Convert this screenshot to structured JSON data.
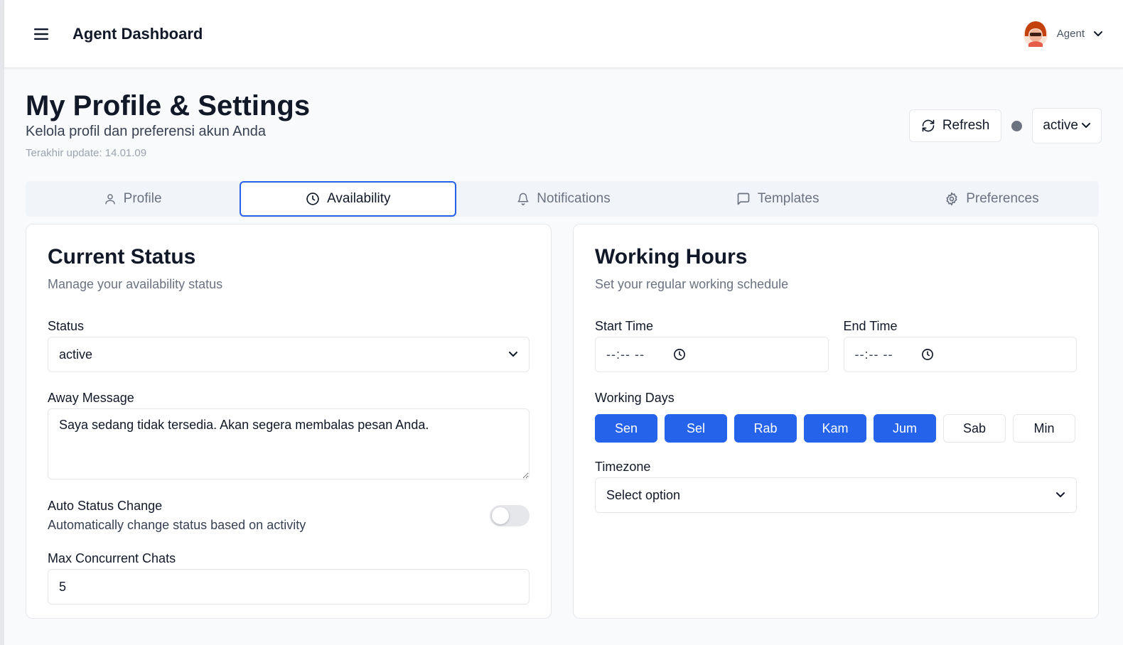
{
  "header": {
    "app_title": "Agent Dashboard",
    "user_name": "Agent"
  },
  "page": {
    "title": "My Profile & Settings",
    "subtitle": "Kelola profil dan preferensi akun Anda",
    "updated": "Terakhir update: 14.01.09",
    "refresh_label": "Refresh",
    "status_value": "active"
  },
  "tabs": [
    {
      "label": "Profile",
      "icon": "user-icon",
      "active": false
    },
    {
      "label": "Availability",
      "icon": "clock-icon",
      "active": true
    },
    {
      "label": "Notifications",
      "icon": "bell-icon",
      "active": false
    },
    {
      "label": "Templates",
      "icon": "message-square-icon",
      "active": false
    },
    {
      "label": "Preferences",
      "icon": "gear-icon",
      "active": false
    }
  ],
  "current_status": {
    "title": "Current Status",
    "subtitle": "Manage your availability status",
    "status_label": "Status",
    "status_value": "active",
    "away_label": "Away Message",
    "away_value": "Saya sedang tidak tersedia. Akan segera membalas pesan Anda.",
    "auto_label": "Auto Status Change",
    "auto_desc": "Automatically change status based on activity",
    "auto_enabled": false,
    "max_label": "Max Concurrent Chats",
    "max_value": "5"
  },
  "working_hours": {
    "title": "Working Hours",
    "subtitle": "Set your regular working schedule",
    "start_label": "Start Time",
    "start_value": "--:-- --",
    "end_label": "End Time",
    "end_value": "--:-- --",
    "days_label": "Working Days",
    "days": [
      {
        "label": "Sen",
        "selected": true
      },
      {
        "label": "Sel",
        "selected": true
      },
      {
        "label": "Rab",
        "selected": true
      },
      {
        "label": "Kam",
        "selected": true
      },
      {
        "label": "Jum",
        "selected": true
      },
      {
        "label": "Sab",
        "selected": false
      },
      {
        "label": "Min",
        "selected": false
      }
    ],
    "timezone_label": "Timezone",
    "timezone_value": "Select option"
  },
  "colors": {
    "accent": "#2563eb",
    "status_dot": "#6b7280",
    "muted_text": "#6b7280"
  }
}
